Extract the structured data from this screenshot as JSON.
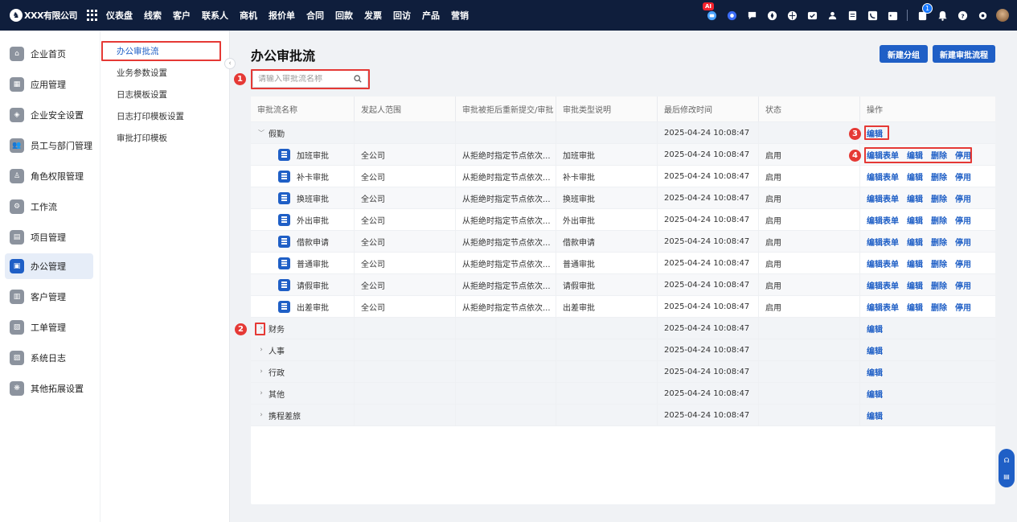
{
  "topbar": {
    "company": "XXX有限公司",
    "nav": [
      "仪表盘",
      "线索",
      "客户",
      "联系人",
      "商机",
      "报价单",
      "合同",
      "回款",
      "发票",
      "回访",
      "产品",
      "营销"
    ],
    "ai_badge": "AI",
    "notification_count": "1"
  },
  "sidebar": {
    "items": [
      {
        "label": "企业首页",
        "icon": "home-icon",
        "glyph": "⌂"
      },
      {
        "label": "应用管理",
        "icon": "apps-icon",
        "glyph": "▦"
      },
      {
        "label": "企业安全设置",
        "icon": "shield-icon",
        "glyph": "◈"
      },
      {
        "label": "员工与部门管理",
        "icon": "users-icon",
        "glyph": "👥"
      },
      {
        "label": "角色权限管理",
        "icon": "user-role-icon",
        "glyph": "♙"
      },
      {
        "label": "工作流",
        "icon": "workflow-icon",
        "glyph": "⚙"
      },
      {
        "label": "项目管理",
        "icon": "project-icon",
        "glyph": "▤"
      },
      {
        "label": "办公管理",
        "icon": "briefcase-icon",
        "glyph": "▣"
      },
      {
        "label": "客户管理",
        "icon": "customer-icon",
        "glyph": "▥"
      },
      {
        "label": "工单管理",
        "icon": "ticket-icon",
        "glyph": "▧"
      },
      {
        "label": "系统日志",
        "icon": "log-icon",
        "glyph": "▨"
      },
      {
        "label": "其他拓展设置",
        "icon": "settings-icon",
        "glyph": "❋"
      }
    ],
    "active_index": 7
  },
  "submenu": {
    "items": [
      "办公审批流",
      "业务参数设置",
      "日志模板设置",
      "日志打印模板设置",
      "审批打印模板"
    ],
    "active_index": 0
  },
  "main": {
    "title": "办公审批流",
    "new_group_label": "新建分组",
    "new_flow_label": "新建审批流程",
    "search_placeholder": "请输入审批流名称"
  },
  "table": {
    "columns": [
      "审批流名称",
      "发起人范围",
      "审批被拒后重新提交/审批",
      "审批类型说明",
      "最后修改时间",
      "状态",
      "操作"
    ],
    "groups": [
      {
        "name": "假勤",
        "expanded": true,
        "modified": "2025-04-24 10:08:47",
        "actions": [
          "编辑"
        ],
        "children": [
          {
            "name": "加班审批",
            "scope": "全公司",
            "resubmit": "从拒绝时指定节点依次...",
            "type": "加班审批",
            "modified": "2025-04-24 10:08:47",
            "status": "启用"
          },
          {
            "name": "补卡审批",
            "scope": "全公司",
            "resubmit": "从拒绝时指定节点依次...",
            "type": "补卡审批",
            "modified": "2025-04-24 10:08:47",
            "status": "启用"
          },
          {
            "name": "换班审批",
            "scope": "全公司",
            "resubmit": "从拒绝时指定节点依次...",
            "type": "换班审批",
            "modified": "2025-04-24 10:08:47",
            "status": "启用"
          },
          {
            "name": "外出审批",
            "scope": "全公司",
            "resubmit": "从拒绝时指定节点依次...",
            "type": "外出审批",
            "modified": "2025-04-24 10:08:47",
            "status": "启用"
          },
          {
            "name": "借款申请",
            "scope": "全公司",
            "resubmit": "从拒绝时指定节点依次...",
            "type": "借款申请",
            "modified": "2025-04-24 10:08:47",
            "status": "启用"
          },
          {
            "name": "普通审批",
            "scope": "全公司",
            "resubmit": "从拒绝时指定节点依次...",
            "type": "普通审批",
            "modified": "2025-04-24 10:08:47",
            "status": "启用"
          },
          {
            "name": "请假审批",
            "scope": "全公司",
            "resubmit": "从拒绝时指定节点依次...",
            "type": "请假审批",
            "modified": "2025-04-24 10:08:47",
            "status": "启用"
          },
          {
            "name": "出差审批",
            "scope": "全公司",
            "resubmit": "从拒绝时指定节点依次...",
            "type": "出差审批",
            "modified": "2025-04-24 10:08:47",
            "status": "启用"
          }
        ]
      },
      {
        "name": "财务",
        "expanded": false,
        "modified": "2025-04-24 10:08:47",
        "actions": [
          "编辑"
        ]
      },
      {
        "name": "人事",
        "expanded": false,
        "modified": "2025-04-24 10:08:47",
        "actions": [
          "编辑"
        ]
      },
      {
        "name": "行政",
        "expanded": false,
        "modified": "2025-04-24 10:08:47",
        "actions": [
          "编辑"
        ]
      },
      {
        "name": "其他",
        "expanded": false,
        "modified": "2025-04-24 10:08:47",
        "actions": [
          "编辑"
        ]
      },
      {
        "name": "携程差旅",
        "expanded": false,
        "modified": "2025-04-24 10:08:47",
        "actions": [
          "编辑"
        ]
      }
    ],
    "child_actions": [
      "编辑表单",
      "编辑",
      "删除",
      "停用"
    ]
  },
  "annotations": [
    "1",
    "2",
    "3",
    "4"
  ],
  "colors": {
    "nav_bg": "#0f1e3c",
    "primary": "#1f5fc6",
    "annotation": "#e53935"
  }
}
